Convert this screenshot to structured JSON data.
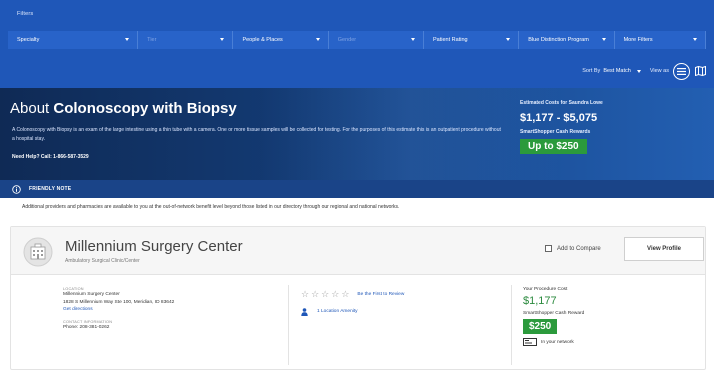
{
  "filters": {
    "label": "Filters",
    "items": [
      {
        "label": "Specialty",
        "width": 134,
        "dim": false
      },
      {
        "label": "Tier",
        "width": 98,
        "dim": true
      },
      {
        "label": "People & Places",
        "width": 98,
        "dim": false
      },
      {
        "label": "Gender",
        "width": 98,
        "dim": true
      },
      {
        "label": "Patient Rating",
        "width": 98,
        "dim": false
      },
      {
        "label": "Blue Distinction Program",
        "width": 98,
        "dim": false
      },
      {
        "label": "More Filters",
        "width": 94,
        "dim": false
      }
    ]
  },
  "sort": {
    "label": "Sort By",
    "value": "Best Match",
    "view_label": "View as"
  },
  "hero": {
    "title_prefix": "About",
    "title_procedure": "Colonoscopy with Biopsy",
    "description": "A Colonoscopy with Biopsy is an exam of the large intestine using a thin tube with a camera. One or more tissue samples will be collected for testing. For the purposes of this estimate this is an outpatient procedure without a hospital stay.",
    "help": "Need Help? Call: 1-866-587-3529",
    "cost_label": "Estimated Costs for Saundra Lowe",
    "cost_range": "$1,177 - $5,075",
    "reward_label": "SmartShopper Cash Rewards",
    "reward_value": "Up to $250"
  },
  "note": {
    "label": "FRIENDLY NOTE",
    "text": "Additional providers and pharmacies are available to you at the out-of-network benefit level beyond those listed in our directory through our regional and national networks."
  },
  "provider": {
    "name": "Millennium Surgery Center",
    "type": "Ambulatory Surgical Clinic/Center",
    "compare_label": "Add to Compare",
    "view_profile_label": "View Profile",
    "location_label": "LOCATION",
    "location_name": "Millennium Surgery Center",
    "address": "1828 S Millennium Way Ste 100, Meridian, ID 83642",
    "directions": "Get directions",
    "contact_label": "CONTACT INFORMATION",
    "phone": "Phone: 208-381-0262",
    "review_link": "Be the First to Review",
    "amenity": "1 Location Amenity",
    "procedure_cost_label": "Your Procedure Cost",
    "procedure_cost": "$1,177",
    "reward_label": "SmartShopper Cash Reward",
    "reward_value": "$250",
    "network_text": "In your network"
  }
}
